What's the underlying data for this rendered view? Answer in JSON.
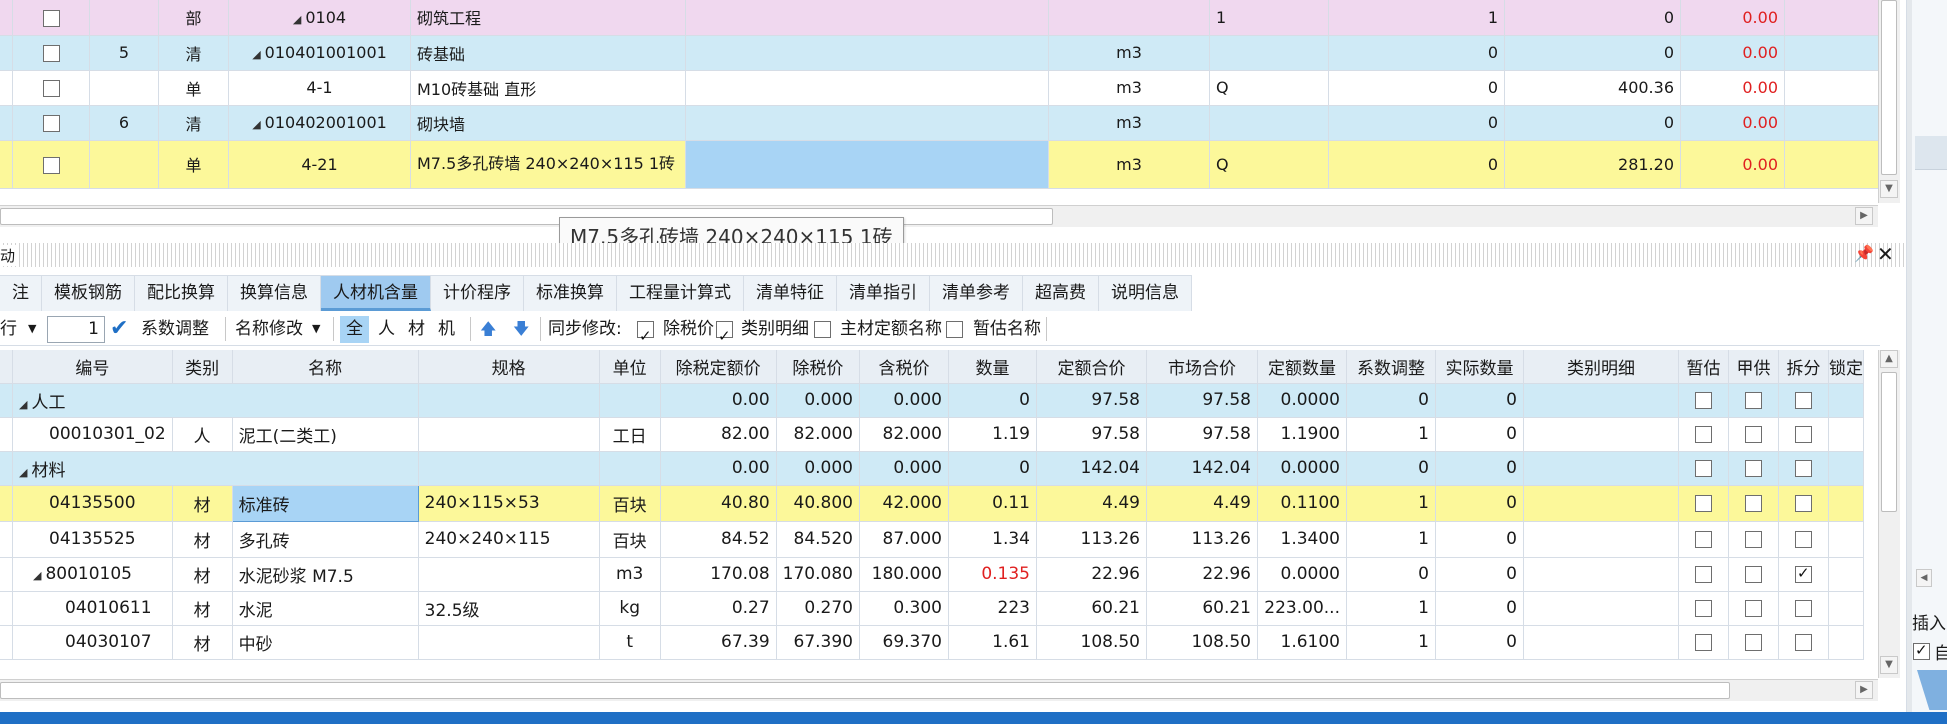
{
  "upper_grid": {
    "rows": [
      {
        "style": "pink",
        "checked": false,
        "num": "",
        "type": "部",
        "expand": true,
        "code": "0104",
        "name": "砌筑工程",
        "unit": "",
        "expr": "1",
        "qty": "1",
        "price": "0",
        "total": "0.00"
      },
      {
        "style": "blue",
        "checked": false,
        "num": "5",
        "type": "清",
        "expand": true,
        "code": "010401001001",
        "name": "砖基础",
        "unit": "m3",
        "expr": "",
        "qty": "0",
        "price": "0",
        "total": "0.00"
      },
      {
        "style": "white",
        "checked": false,
        "num": "",
        "type": "单",
        "expand": false,
        "code": "4-1",
        "name": "M10砖基础 直形",
        "unit": "m3",
        "expr": "Q",
        "qty": "0",
        "price": "400.36",
        "total": "0.00"
      },
      {
        "style": "blue",
        "checked": false,
        "num": "6",
        "type": "清",
        "expand": true,
        "code": "010402001001",
        "name": "砌块墙",
        "unit": "m3",
        "expr": "",
        "qty": "0",
        "price": "0",
        "total": "0.00"
      },
      {
        "style": "yellow",
        "checked": false,
        "num": "",
        "type": "单",
        "expand": false,
        "code": "4-21",
        "name": "M7.5多孔砖墙 240×240×115 1砖",
        "unit": "m3",
        "expr": "Q",
        "qty": "0",
        "price": "281.20",
        "total": "0.00"
      }
    ]
  },
  "tooltip": "M7.5多孔砖墙 240×240×115 1砖",
  "panel": {
    "title": "动",
    "tabs": [
      "注",
      "模板钢筋",
      "配比换算",
      "换算信息",
      "人材机含量",
      "计价程序",
      "标准换算",
      "工程量计算式",
      "清单特征",
      "清单指引",
      "清单参考",
      "超高费",
      "说明信息"
    ],
    "active_tab": "人材机含量"
  },
  "toolbar": {
    "row_label": "行",
    "row_value": "1",
    "coef_label": "系数调整",
    "rename_label": "名称修改",
    "filter_all": "全",
    "filter_labor": "人",
    "filter_material": "材",
    "filter_machine": "机",
    "sync_label": "同步修改:",
    "opt1": "除税价",
    "opt2": "类别明细",
    "opt3": "主材定额名称",
    "opt4": "暂估名称"
  },
  "lower_grid": {
    "headers": [
      "编号",
      "类别",
      "名称",
      "规格",
      "单位",
      "除税定额价",
      "除税价",
      "含税价",
      "数量",
      "定额合价",
      "市场合价",
      "定额数量",
      "系数调整",
      "实际数量",
      "类别明细",
      "暂估",
      "甲供",
      "拆分",
      "锁定"
    ],
    "rows": [
      {
        "style": "blue",
        "group": true,
        "code": "人工",
        "type": "",
        "name": "",
        "spec": "",
        "unit": "",
        "p1": "0.00",
        "p2": "0.000",
        "p3": "0.000",
        "qty": "0",
        "t1": "97.58",
        "t2": "97.58",
        "dq": "0.0000",
        "coef": "0",
        "aq": "0",
        "split": false
      },
      {
        "style": "white",
        "group": false,
        "code": "00010301_02",
        "type": "人",
        "name": "泥工(二类工)",
        "spec": "",
        "unit": "工日",
        "p1": "82.00",
        "p2": "82.000",
        "p3": "82.000",
        "qty": "1.19",
        "t1": "97.58",
        "t2": "97.58",
        "dq": "1.1900",
        "coef": "1",
        "aq": "0",
        "split": false
      },
      {
        "style": "blue",
        "group": true,
        "code": "材料",
        "type": "",
        "name": "",
        "spec": "",
        "unit": "",
        "p1": "0.00",
        "p2": "0.000",
        "p3": "0.000",
        "qty": "0",
        "t1": "142.04",
        "t2": "142.04",
        "dq": "0.0000",
        "coef": "0",
        "aq": "0",
        "split": false
      },
      {
        "style": "yellow",
        "group": false,
        "code": "04135500",
        "type": "材",
        "name": "标准砖",
        "spec": "240×115×53",
        "unit": "百块",
        "p1": "40.80",
        "p2": "40.800",
        "p3": "42.000",
        "qty": "0.11",
        "t1": "4.49",
        "t2": "4.49",
        "dq": "0.1100",
        "coef": "1",
        "aq": "0",
        "split": false
      },
      {
        "style": "white",
        "group": false,
        "code": "04135525",
        "type": "材",
        "name": "多孔砖",
        "spec": "240×240×115",
        "unit": "百块",
        "p1": "84.52",
        "p2": "84.520",
        "p3": "87.000",
        "qty": "1.34",
        "t1": "113.26",
        "t2": "113.26",
        "dq": "1.3400",
        "coef": "1",
        "aq": "0",
        "split": false
      },
      {
        "style": "white",
        "group": false,
        "expand": true,
        "code": "80010105",
        "type": "材",
        "name": "水泥砂浆 M7.5",
        "spec": "",
        "unit": "m3",
        "p1": "170.08",
        "p2": "170.080",
        "p3": "180.000",
        "qty": "0.135",
        "qtyRed": true,
        "t1": "22.96",
        "t2": "22.96",
        "dq": "0.0000",
        "coef": "0",
        "aq": "0",
        "split": true
      },
      {
        "style": "white",
        "group": false,
        "indent": true,
        "code": "04010611",
        "type": "材",
        "name": "水泥",
        "spec": "32.5级",
        "unit": "kg",
        "p1": "0.27",
        "p2": "0.270",
        "p3": "0.300",
        "qty": "223",
        "t1": "60.21",
        "t2": "60.21",
        "dq": "223.00...",
        "coef": "1",
        "aq": "0",
        "split": false
      },
      {
        "style": "white",
        "group": false,
        "indent": true,
        "code": "04030107",
        "type": "材",
        "name": "中砂",
        "spec": "",
        "unit": "t",
        "p1": "67.39",
        "p2": "67.390",
        "p3": "69.370",
        "qty": "1.61",
        "t1": "108.50",
        "t2": "108.50",
        "dq": "1.6100",
        "coef": "1",
        "aq": "0",
        "split": false
      }
    ]
  },
  "right_panel": {
    "insert_label": "插入",
    "auto_label": "自"
  },
  "colors": {
    "accent": "#5b9bd5",
    "row_blue": "#cfeaf6",
    "row_yellow": "#fcf89a",
    "row_pink": "#f0d8ef",
    "red_text": "#e02020",
    "status_bar": "#1f6fc5"
  }
}
